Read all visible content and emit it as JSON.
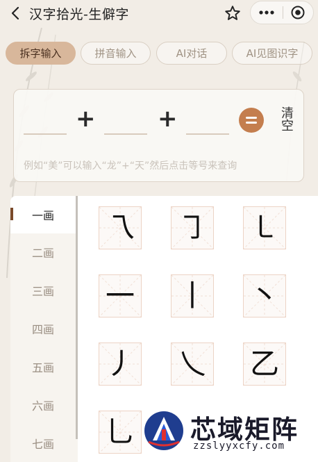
{
  "app": {
    "title": "汉字拾光-生僻字"
  },
  "tabs": [
    {
      "label": "拆字输入",
      "active": true
    },
    {
      "label": "拼音输入",
      "active": false
    },
    {
      "label": "AI对话",
      "active": false
    },
    {
      "label": "AI见图识字",
      "active": false
    }
  ],
  "composer": {
    "plus_symbol": "+",
    "clear_label": "清空",
    "hint": "例如“美”可以输入“龙”+“天”然后点击等号来查询"
  },
  "strokes_sidebar": {
    "items": [
      "一画",
      "二画",
      "三画",
      "四画",
      "五画",
      "六画",
      "七画"
    ],
    "selected": "一画"
  },
  "stroke_grid": {
    "cells": [
      "乁",
      "㇆",
      "㇄",
      "一",
      "丨",
      "丶",
      "丿",
      "乀",
      "乙",
      "乚"
    ]
  },
  "watermark": {
    "title": "芯域矩阵",
    "url": "zzslyyxcfy.com"
  },
  "colors": {
    "accent": "#c47e4e",
    "tab_active": "#d8b79b",
    "indicator": "#7a4a2a",
    "background": "#f2ede6"
  },
  "icons": {
    "back": "chevron-left-icon",
    "star": "star-icon",
    "more": "more-icon",
    "target": "target-icon",
    "equals": "equals-icon"
  }
}
